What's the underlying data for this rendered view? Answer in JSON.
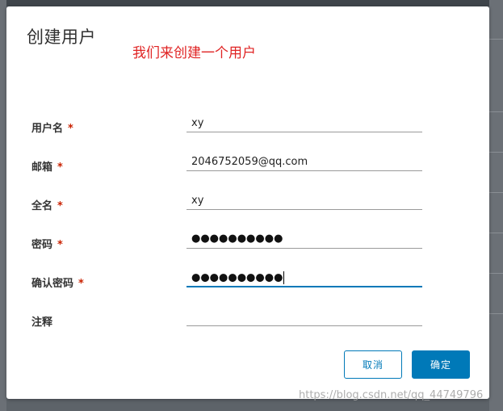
{
  "dialog": {
    "title": "创建用户",
    "annotation": "我们来创建一个用户"
  },
  "form": {
    "username": {
      "label": "用户名",
      "required_mark": "*",
      "value": "xy"
    },
    "email": {
      "label": "邮箱",
      "required_mark": "*",
      "value": "2046752059@qq.com"
    },
    "fullname": {
      "label": "全名",
      "required_mark": "*",
      "value": "xy"
    },
    "password": {
      "label": "密码",
      "required_mark": "*",
      "masked_value": "●●●●●●●●●●"
    },
    "confirm_password": {
      "label": "确认密码",
      "required_mark": "*",
      "masked_value": "●●●●●●●●●●"
    },
    "comment": {
      "label": "注释",
      "value": ""
    }
  },
  "buttons": {
    "cancel_label": "取消",
    "ok_label": "确定"
  },
  "watermark": "https://blog.csdn.net/qq_44749796",
  "colors": {
    "accent": "#0079b8",
    "required": "#c92100",
    "annotation": "#e02424"
  }
}
